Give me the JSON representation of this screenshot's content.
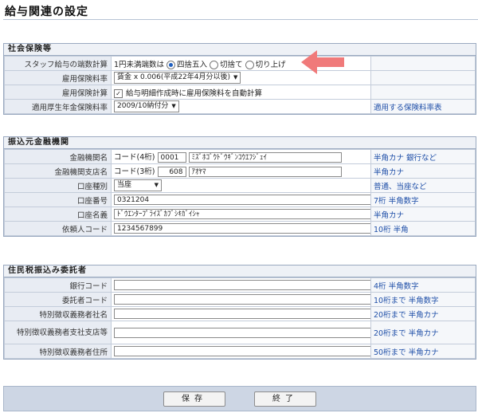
{
  "page": {
    "title": "給与関連の設定"
  },
  "social_insurance": {
    "heading": "社会保険等",
    "rows": {
      "rounding": {
        "label": "スタッフ給与の端数計算",
        "prefix": "1円未満端数は",
        "options": [
          "四捨五入",
          "切捨て",
          "切り上げ"
        ],
        "selected": "四捨五入"
      },
      "employment_rate": {
        "label": "雇用保険料率",
        "value": "賃金 x 0.006(平成22年4月分以後)"
      },
      "employment_calc": {
        "label": "雇用保険計算",
        "checkbox_label": "給与明細作成時に雇用保険料を自動計算",
        "checked": true
      },
      "welfare_rate": {
        "label": "適用厚生年金保険料率",
        "value": "2009/10納付分",
        "link": "適用する保険料率表"
      }
    }
  },
  "bank": {
    "heading": "振込元金融機関",
    "rows": {
      "bank_name": {
        "label": "金融機関名",
        "code_label": "コード(4桁)",
        "code": "0001",
        "name": "ﾐｽﾞﾎｺﾞｳﾄﾞｳｷﾞﾝｺｳｴﾌｼﾞｪｲ",
        "note": "半角カナ 銀行など"
      },
      "branch": {
        "label": "金融機関支店名",
        "code_label": "コード(3桁)",
        "code": "608",
        "name": "ｱｵﾔﾏ",
        "note": "半角カナ"
      },
      "account_type": {
        "label": "口座種別",
        "value": "当座",
        "note": "普通、当座など"
      },
      "account_number": {
        "label": "口座番号",
        "value": "0321204",
        "note": "7桁 半角数字"
      },
      "account_name": {
        "label": "口座名義",
        "value": "ﾄﾞｳｴﾝﾀｰﾌﾟﾗｲｽﾞｶﾌﾞｼｷｶﾞｲｼｬ",
        "note": "半角カナ"
      },
      "requester_code": {
        "label": "依頼人コード",
        "value": "1234567899",
        "note": "10桁 半角"
      }
    }
  },
  "resident_tax": {
    "heading": "住民税振込み委託者",
    "rows": {
      "bank_code": {
        "label": "銀行コード",
        "value": "",
        "note": "4桁 半角数字"
      },
      "consignor_code": {
        "label": "委託者コード",
        "value": "",
        "note": "10桁まで 半角数字"
      },
      "company_name": {
        "label": "特別徴収義務者社名",
        "value": "",
        "note": "20桁まで 半角カナ"
      },
      "branch_name": {
        "label": "特別徴収義務者支社支店等",
        "value": "",
        "note": "20桁まで 半角カナ"
      },
      "address": {
        "label": "特別徴収義務者住所",
        "value": "",
        "note": "50桁まで 半角カナ"
      }
    }
  },
  "buttons": {
    "save": "保存",
    "close": "終了"
  },
  "colors": {
    "arrow": "#f07a7a",
    "link": "#1f4fa8",
    "header_bg": "#eef1f6"
  }
}
